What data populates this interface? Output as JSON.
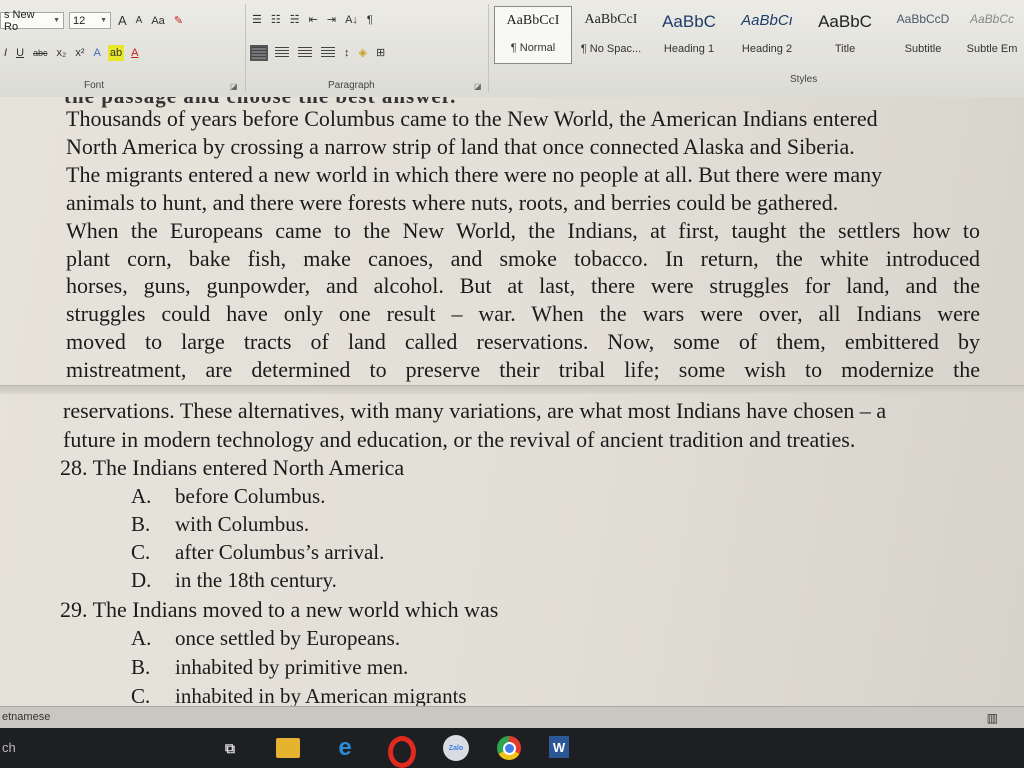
{
  "ribbon": {
    "font": {
      "family": "s New Ro",
      "size": "12",
      "grow_label": "A",
      "shrink_label": "A",
      "case_label": "Aa",
      "underline_label": "U",
      "strike_label": "abc",
      "subscript_label": "x₂",
      "superscript_label": "x²",
      "effects_label": "A",
      "highlight_label": "ab",
      "color_label": "A",
      "group_label": "Font"
    },
    "paragraph": {
      "group_label": "Paragraph",
      "sort_label": "A↓",
      "pilcrow_label": "¶"
    },
    "styles": {
      "group_label": "Styles",
      "items": [
        {
          "preview": "AaBbCcI",
          "name": "¶ Normal"
        },
        {
          "preview": "AaBbCcI",
          "name": "¶ No Spac..."
        },
        {
          "preview": "AaBbC",
          "name": "Heading 1"
        },
        {
          "preview": "AaBbCı",
          "name": "Heading 2"
        },
        {
          "preview": "AaBbC",
          "name": "Title"
        },
        {
          "preview": "AaBbCcD",
          "name": "Subtitle"
        },
        {
          "preview": "AaBbCc",
          "name": "Subtle Em"
        }
      ]
    }
  },
  "document": {
    "cut_heading": "the passage and choose the best answer.",
    "paragraph1": [
      "Thousands of years before Columbus came to the New World, the American Indians entered",
      "North America by crossing a narrow strip of land that once connected Alaska and Siberia.",
      "The migrants entered a new world in which there were no people at all. But there were many",
      "animals to hunt, and there were forests where nuts, roots, and berries could be gathered.",
      "When the Europeans came to the New World, the Indians, at first, taught the settlers how to",
      "plant corn, bake fish, make canoes, and smoke tobacco. In return, the white introduced",
      "horses, guns, gunpowder, and alcohol. But at last, there were struggles for land, and the",
      "struggles could have only one result – war. When the wars were over, all Indians were",
      "moved to large tracts of land called reservations. Now, some of them, embittered by",
      "mistreatment, are determined to preserve their tribal life; some wish to modernize the"
    ],
    "paragraph2": [
      "reservations. These alternatives, with many variations, are what most Indians have chosen – a",
      "future in modern technology and education, or the revival of ancient tradition and treaties."
    ],
    "questions": [
      {
        "stem": "28. The Indians entered North America",
        "options": [
          {
            "letter": "A.",
            "text": "before Columbus."
          },
          {
            "letter": "B.",
            "text": "with Columbus."
          },
          {
            "letter": "C.",
            "text": "after Columbus’s arrival."
          },
          {
            "letter": "D.",
            "text": "in the 18th century."
          }
        ]
      },
      {
        "stem": "29. The Indians moved to a new world which was",
        "options": [
          {
            "letter": "A.",
            "text": "once settled by Europeans."
          },
          {
            "letter": "B.",
            "text": "inhabited by primitive men."
          },
          {
            "letter": "C.",
            "text": "inhabited in by American migrants"
          }
        ]
      }
    ]
  },
  "statusbar": {
    "language": "etnamese"
  },
  "taskbar": {
    "search_text": "ch",
    "zalo_label": "Zalo",
    "word_label": "W",
    "icons": [
      "task-view-icon",
      "file-explorer-icon",
      "edge-icon",
      "opera-icon",
      "zalo-icon",
      "chrome-icon",
      "word-icon"
    ]
  }
}
